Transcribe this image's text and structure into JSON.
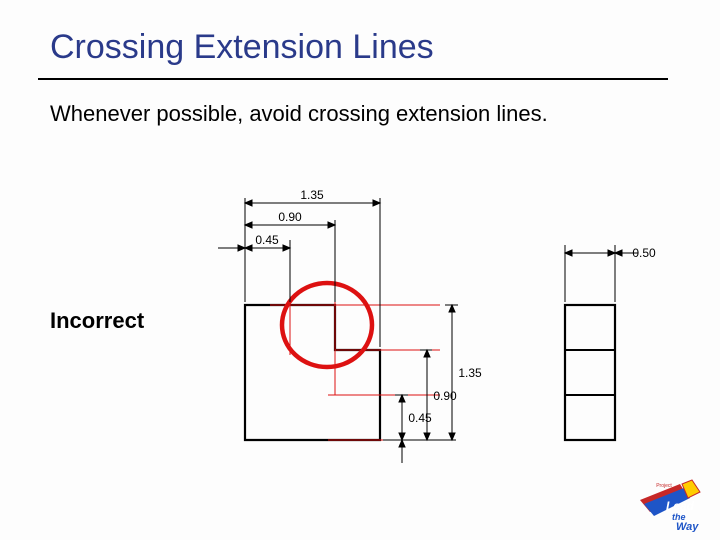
{
  "title": "Crossing Extension Lines",
  "body": "Whenever possible, avoid crossing extension lines.",
  "label": "Incorrect",
  "dims": {
    "h1": "1.35",
    "h2": "0.90",
    "h3": "0.45",
    "v1": "1.35",
    "v2": "0.90",
    "v3": "0.45",
    "side": "0.50"
  },
  "logo": {
    "top": "Project",
    "line1": "Lead",
    "line2": "the",
    "line3": "Way"
  }
}
